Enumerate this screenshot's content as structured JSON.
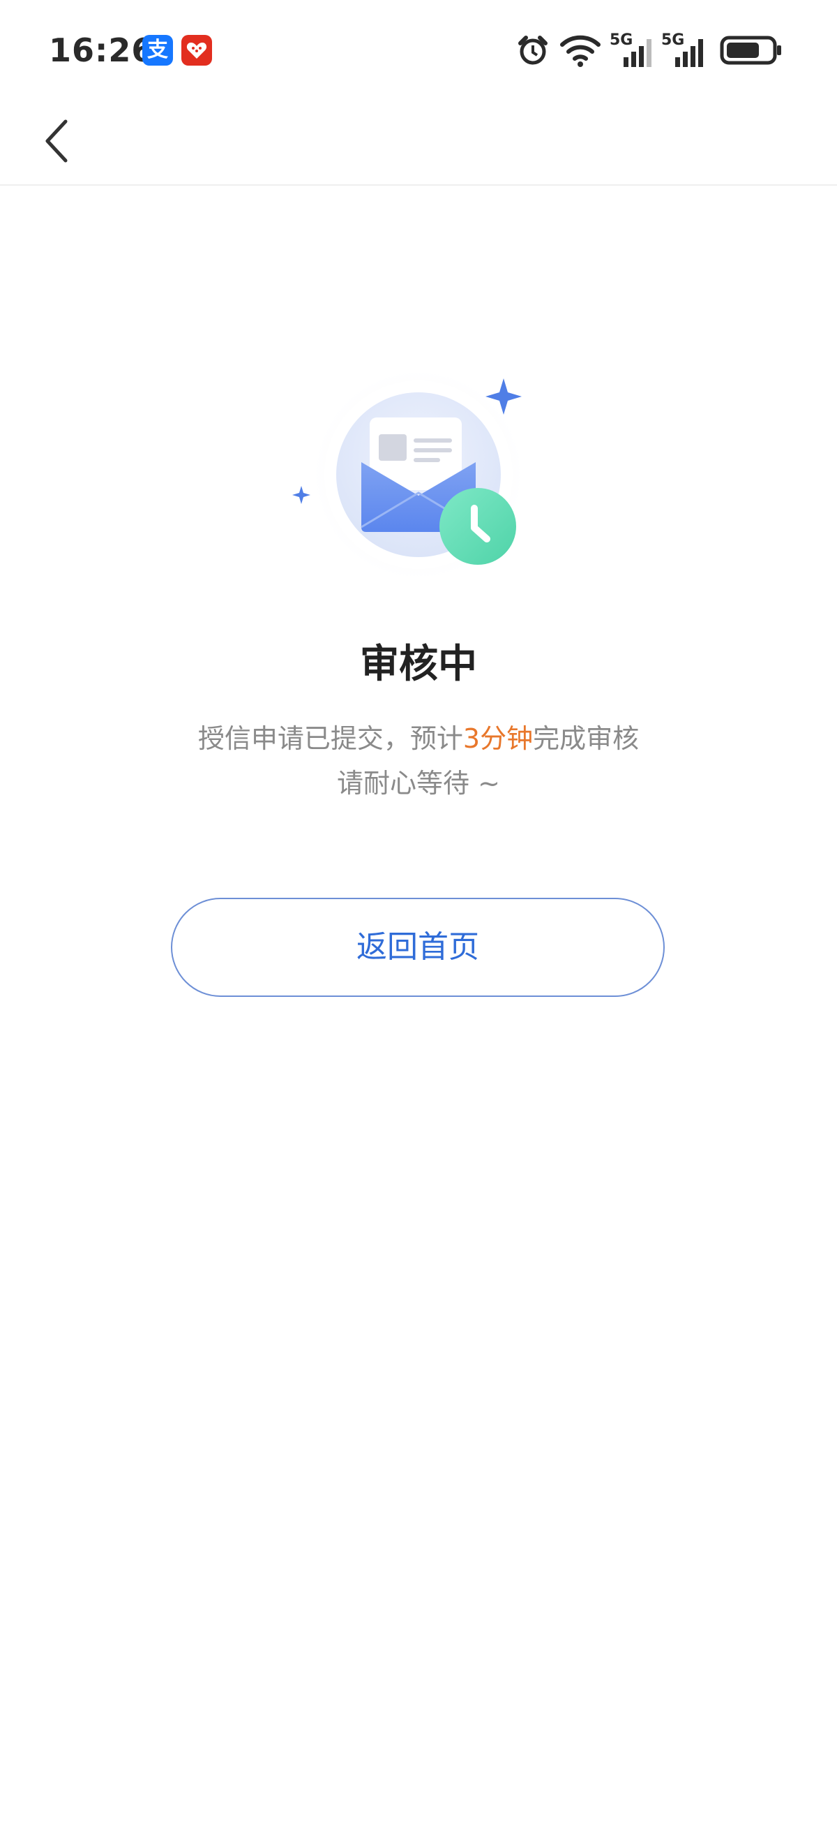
{
  "status_bar": {
    "time": "16:26",
    "alipay_badge": "支",
    "network_1": "5G",
    "network_2": "5G"
  },
  "icons": {
    "back": "chevron-left-icon",
    "alarm": "alarm-clock-icon",
    "wifi": "wifi-icon",
    "signal": "cellular-signal-icon",
    "battery": "battery-icon",
    "illustration": "envelope-clock-illustration"
  },
  "main": {
    "title": "审核中",
    "desc_line1_prefix": "授信申请已提交，预计",
    "desc_line1_highlight": "3分钟",
    "desc_line1_suffix": "完成审核",
    "desc_line2": "请耐心等待 ~",
    "button_label": "返回首页"
  },
  "colors": {
    "accent_blue": "#2f6cd8",
    "highlight_orange": "#e8772b",
    "clock_green": "#5fdcb5",
    "sparkle_blue": "#4f7ee6"
  }
}
